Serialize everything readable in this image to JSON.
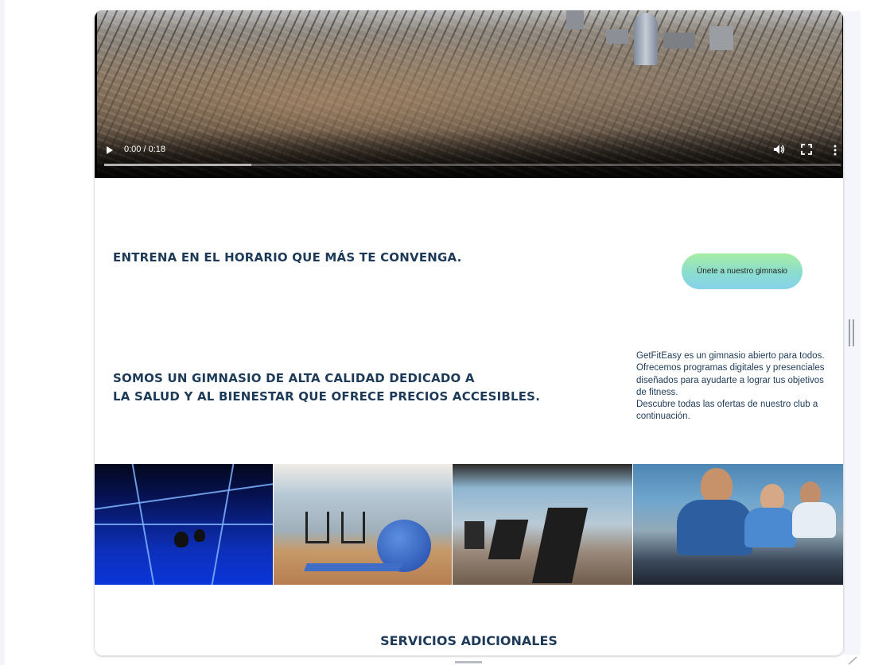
{
  "video": {
    "time": "0:00 / 0:18",
    "progress_fraction": 0.2,
    "icons": [
      "play-icon",
      "volume-icon",
      "fullscreen-icon",
      "more-vert-icon"
    ]
  },
  "hero": {
    "headline1": "ENTRENA EN EL HORARIO QUE MÁS TE CONVENGA.",
    "cta": "Únete a nuestro gimnasio",
    "headline2_line1": "SOMOS UN GIMNASIO DE ALTA CALIDAD DEDICADO A",
    "headline2_line2": "LA SALUD Y AL BIENESTAR QUE OFRECE PRECIOS ACCESIBLES.",
    "description_line1": "GetFitEasy es un gimnasio abierto para todos. Ofrecemos programas digitales y presenciales diseñados para ayudarte a lograr tus objetivos de fitness.",
    "description_line2": "Descubre todas las ofertas de nuestro club a continuación."
  },
  "gallery": {
    "images": [
      "boxing-room",
      "cardio-room-with-fitball",
      "treadmills-room",
      "spinning-class"
    ]
  },
  "services": {
    "title": "SERVICIOS ADICIONALES"
  },
  "colors": {
    "heading": "#1d3b58",
    "cta_gradient_top": "#a6eea4",
    "cta_gradient_bottom": "#86d2ea"
  }
}
